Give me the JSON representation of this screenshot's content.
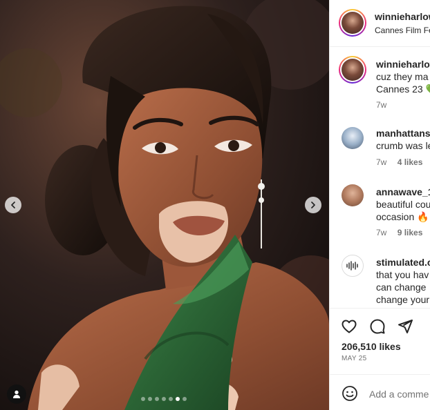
{
  "post": {
    "username": "winnieharlow",
    "location": "Cannes Film Festival",
    "media": {
      "carousel_count": 7,
      "active_index": 5
    },
    "likes": "206,510 likes",
    "date": "MAY 25"
  },
  "caption": {
    "username": "winnieharlow",
    "line1": "cuz they ma",
    "line2": "Cannes 23 💚",
    "time": "7w"
  },
  "comments": [
    {
      "username": "manhattans",
      "lines": [
        "crumb was le"
      ],
      "time": "7w",
      "likes": "4 likes"
    },
    {
      "username": "annawave_1",
      "lines": [
        "beautiful cou",
        "occasion 🔥"
      ],
      "time": "7w",
      "likes": "9 likes"
    },
    {
      "username": "stimulated.c",
      "lines": [
        "that you hav",
        "can change",
        "change your"
      ],
      "time": "",
      "likes": ""
    }
  ],
  "add_comment": {
    "placeholder": "Add a comme"
  },
  "icons": {
    "prev": "chevron-left-icon",
    "next": "chevron-right-icon",
    "tag": "person-tag-icon",
    "like": "heart-icon",
    "comment": "comment-bubble-icon",
    "share": "paper-plane-icon",
    "emoji": "emoji-icon"
  },
  "colors": {
    "dress": "#2f6e3a",
    "story_ring": "#ee2a7b",
    "text": "#262626",
    "muted": "#737373"
  }
}
